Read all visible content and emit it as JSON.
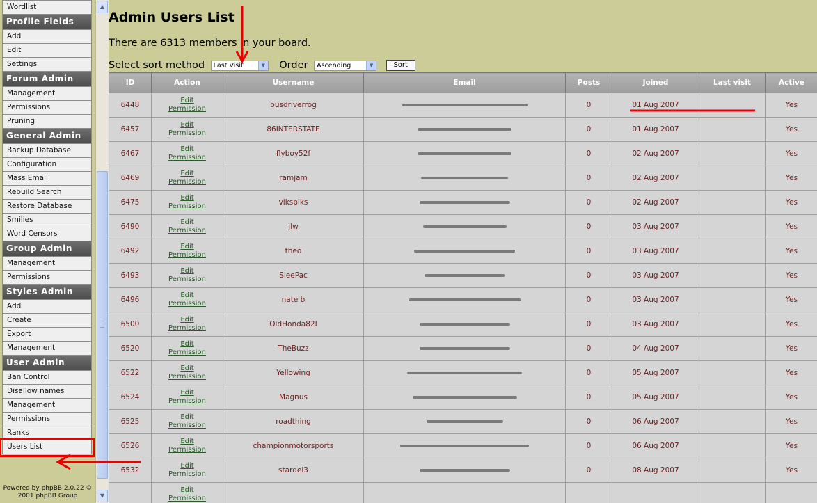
{
  "sidebar": {
    "items": [
      {
        "type": "item",
        "label": "Wordlist"
      },
      {
        "type": "cat",
        "label": "Profile Fields"
      },
      {
        "type": "item",
        "label": "Add"
      },
      {
        "type": "item",
        "label": "Edit"
      },
      {
        "type": "item",
        "label": "Settings"
      },
      {
        "type": "cat",
        "label": "Forum Admin"
      },
      {
        "type": "item",
        "label": "Management"
      },
      {
        "type": "item",
        "label": "Permissions"
      },
      {
        "type": "item",
        "label": "Pruning"
      },
      {
        "type": "cat",
        "label": "General Admin"
      },
      {
        "type": "item",
        "label": "Backup Database"
      },
      {
        "type": "item",
        "label": "Configuration"
      },
      {
        "type": "item",
        "label": "Mass Email"
      },
      {
        "type": "item",
        "label": "Rebuild Search"
      },
      {
        "type": "item",
        "label": "Restore Database"
      },
      {
        "type": "item",
        "label": "Smilies"
      },
      {
        "type": "item",
        "label": "Word Censors"
      },
      {
        "type": "cat",
        "label": "Group Admin"
      },
      {
        "type": "item",
        "label": "Management"
      },
      {
        "type": "item",
        "label": "Permissions"
      },
      {
        "type": "cat",
        "label": "Styles Admin"
      },
      {
        "type": "item",
        "label": "Add"
      },
      {
        "type": "item",
        "label": "Create"
      },
      {
        "type": "item",
        "label": "Export"
      },
      {
        "type": "item",
        "label": "Management"
      },
      {
        "type": "cat",
        "label": "User Admin"
      },
      {
        "type": "item",
        "label": "Ban Control"
      },
      {
        "type": "item",
        "label": "Disallow names"
      },
      {
        "type": "item",
        "label": "Management"
      },
      {
        "type": "item",
        "label": "Permissions"
      },
      {
        "type": "item",
        "label": "Ranks"
      },
      {
        "type": "item",
        "label": "Users List",
        "highlighted": true
      }
    ],
    "powered_line1": "Powered by phpBB 2.0.22 ©",
    "powered_line2": "2001 phpBB Group"
  },
  "main": {
    "title": "Admin Users List",
    "members_text": "There are 6313 members in your board.",
    "sort_label": "Select sort method",
    "sort_value": "Last Visit",
    "order_label": "Order",
    "order_value": "Ascending",
    "sort_button": "Sort"
  },
  "table": {
    "columns": [
      "ID",
      "Action",
      "Username",
      "Email",
      "Posts",
      "Joined",
      "Last visit",
      "Active"
    ],
    "edit_label": "Edit",
    "permission_label": "Permission",
    "rows": [
      {
        "id": "6448",
        "username": "busdriverrog",
        "posts": "0",
        "joined": "01 Aug 2007",
        "last_visit": "",
        "active": "Yes",
        "email_len": 180
      },
      {
        "id": "6457",
        "username": "86INTERSTATE",
        "posts": "0",
        "joined": "01 Aug 2007",
        "last_visit": "",
        "active": "Yes",
        "email_len": 135
      },
      {
        "id": "6467",
        "username": "flyboy52f",
        "posts": "0",
        "joined": "02 Aug 2007",
        "last_visit": "",
        "active": "Yes",
        "email_len": 135
      },
      {
        "id": "6469",
        "username": "ramjam",
        "posts": "0",
        "joined": "02 Aug 2007",
        "last_visit": "",
        "active": "Yes",
        "email_len": 125
      },
      {
        "id": "6475",
        "username": "vikspiks",
        "posts": "0",
        "joined": "02 Aug 2007",
        "last_visit": "",
        "active": "Yes",
        "email_len": 130
      },
      {
        "id": "6490",
        "username": "jlw",
        "posts": "0",
        "joined": "03 Aug 2007",
        "last_visit": "",
        "active": "Yes",
        "email_len": 120
      },
      {
        "id": "6492",
        "username": "theo",
        "posts": "0",
        "joined": "03 Aug 2007",
        "last_visit": "",
        "active": "Yes",
        "email_len": 145
      },
      {
        "id": "6493",
        "username": "SleePac",
        "posts": "0",
        "joined": "03 Aug 2007",
        "last_visit": "",
        "active": "Yes",
        "email_len": 115
      },
      {
        "id": "6496",
        "username": "nate b",
        "posts": "0",
        "joined": "03 Aug 2007",
        "last_visit": "",
        "active": "Yes",
        "email_len": 160
      },
      {
        "id": "6500",
        "username": "OldHonda82I",
        "posts": "0",
        "joined": "03 Aug 2007",
        "last_visit": "",
        "active": "Yes",
        "email_len": 130
      },
      {
        "id": "6520",
        "username": "TheBuzz",
        "posts": "0",
        "joined": "04 Aug 2007",
        "last_visit": "",
        "active": "Yes",
        "email_len": 130
      },
      {
        "id": "6522",
        "username": "Yellowing",
        "posts": "0",
        "joined": "05 Aug 2007",
        "last_visit": "",
        "active": "Yes",
        "email_len": 165
      },
      {
        "id": "6524",
        "username": "Magnus",
        "posts": "0",
        "joined": "05 Aug 2007",
        "last_visit": "",
        "active": "Yes",
        "email_len": 150
      },
      {
        "id": "6525",
        "username": "roadthing",
        "posts": "0",
        "joined": "06 Aug 2007",
        "last_visit": "",
        "active": "Yes",
        "email_len": 110
      },
      {
        "id": "6526",
        "username": "championmotorsports",
        "posts": "0",
        "joined": "06 Aug 2007",
        "last_visit": "",
        "active": "Yes",
        "email_len": 185
      },
      {
        "id": "6532",
        "username": "stardei3",
        "posts": "0",
        "joined": "08 Aug 2007",
        "last_visit": "",
        "active": "Yes",
        "email_len": 130
      },
      {
        "id": "",
        "username": "",
        "posts": "",
        "joined": "",
        "last_visit": "",
        "active": "",
        "email_len": 0
      }
    ]
  },
  "colors": {
    "background": "#cccc99",
    "category_header": "#5a5a5a",
    "table_text": "#6b1f1f",
    "annotation_red": "#ee0000"
  }
}
